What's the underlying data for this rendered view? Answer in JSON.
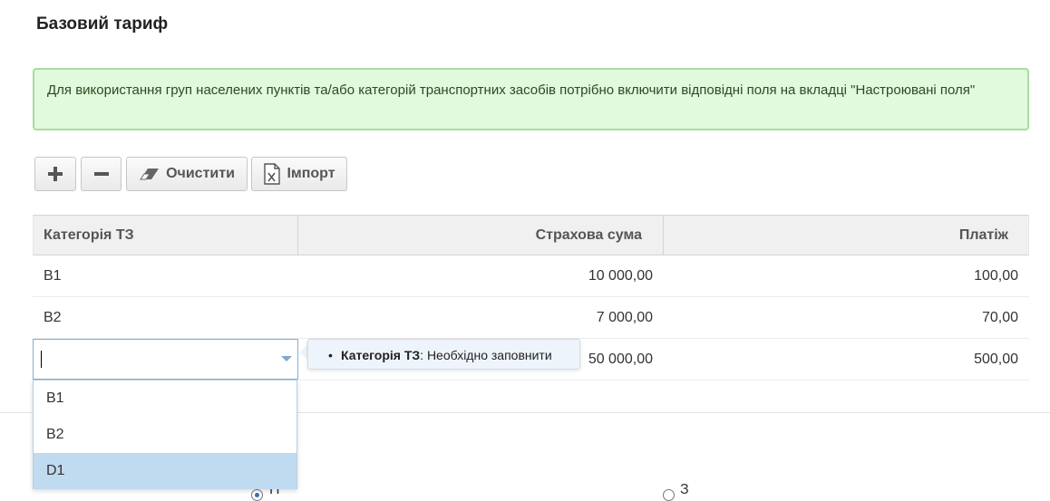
{
  "page": {
    "title": "Базовий тариф"
  },
  "alert": {
    "text": "Для використання груп населених пунктів та/або категорій транспортних засобів потрібно включити відповідні поля на вкладці \"Настроювані поля\"",
    "color": "#e1f9dc"
  },
  "toolbar": {
    "add_icon": "plus-icon",
    "remove_icon": "minus-icon",
    "clear_label": "Очистити",
    "clear_icon": "eraser-icon",
    "import_label": "Імпорт",
    "import_icon": "excel-file-icon"
  },
  "grid": {
    "columns": [
      "Категорія ТЗ",
      "Страхова сума",
      "Платіж"
    ],
    "rows": [
      {
        "category": "B1",
        "sum": "10 000,00",
        "payment": "100,00"
      },
      {
        "category": "B2",
        "sum": "7 000,00",
        "payment": "70,00"
      },
      {
        "category": "",
        "sum": "50 000,00",
        "payment": "500,00"
      }
    ]
  },
  "validation": {
    "field": "Категорія ТЗ",
    "message": ": Необхідно заповнити"
  },
  "dropdown": {
    "options": [
      "B1",
      "B2",
      "D1"
    ],
    "highlighted": "D1",
    "highlight_color": "#c0daf0"
  },
  "bottom": {
    "left_text": "П",
    "right_text": "З"
  }
}
